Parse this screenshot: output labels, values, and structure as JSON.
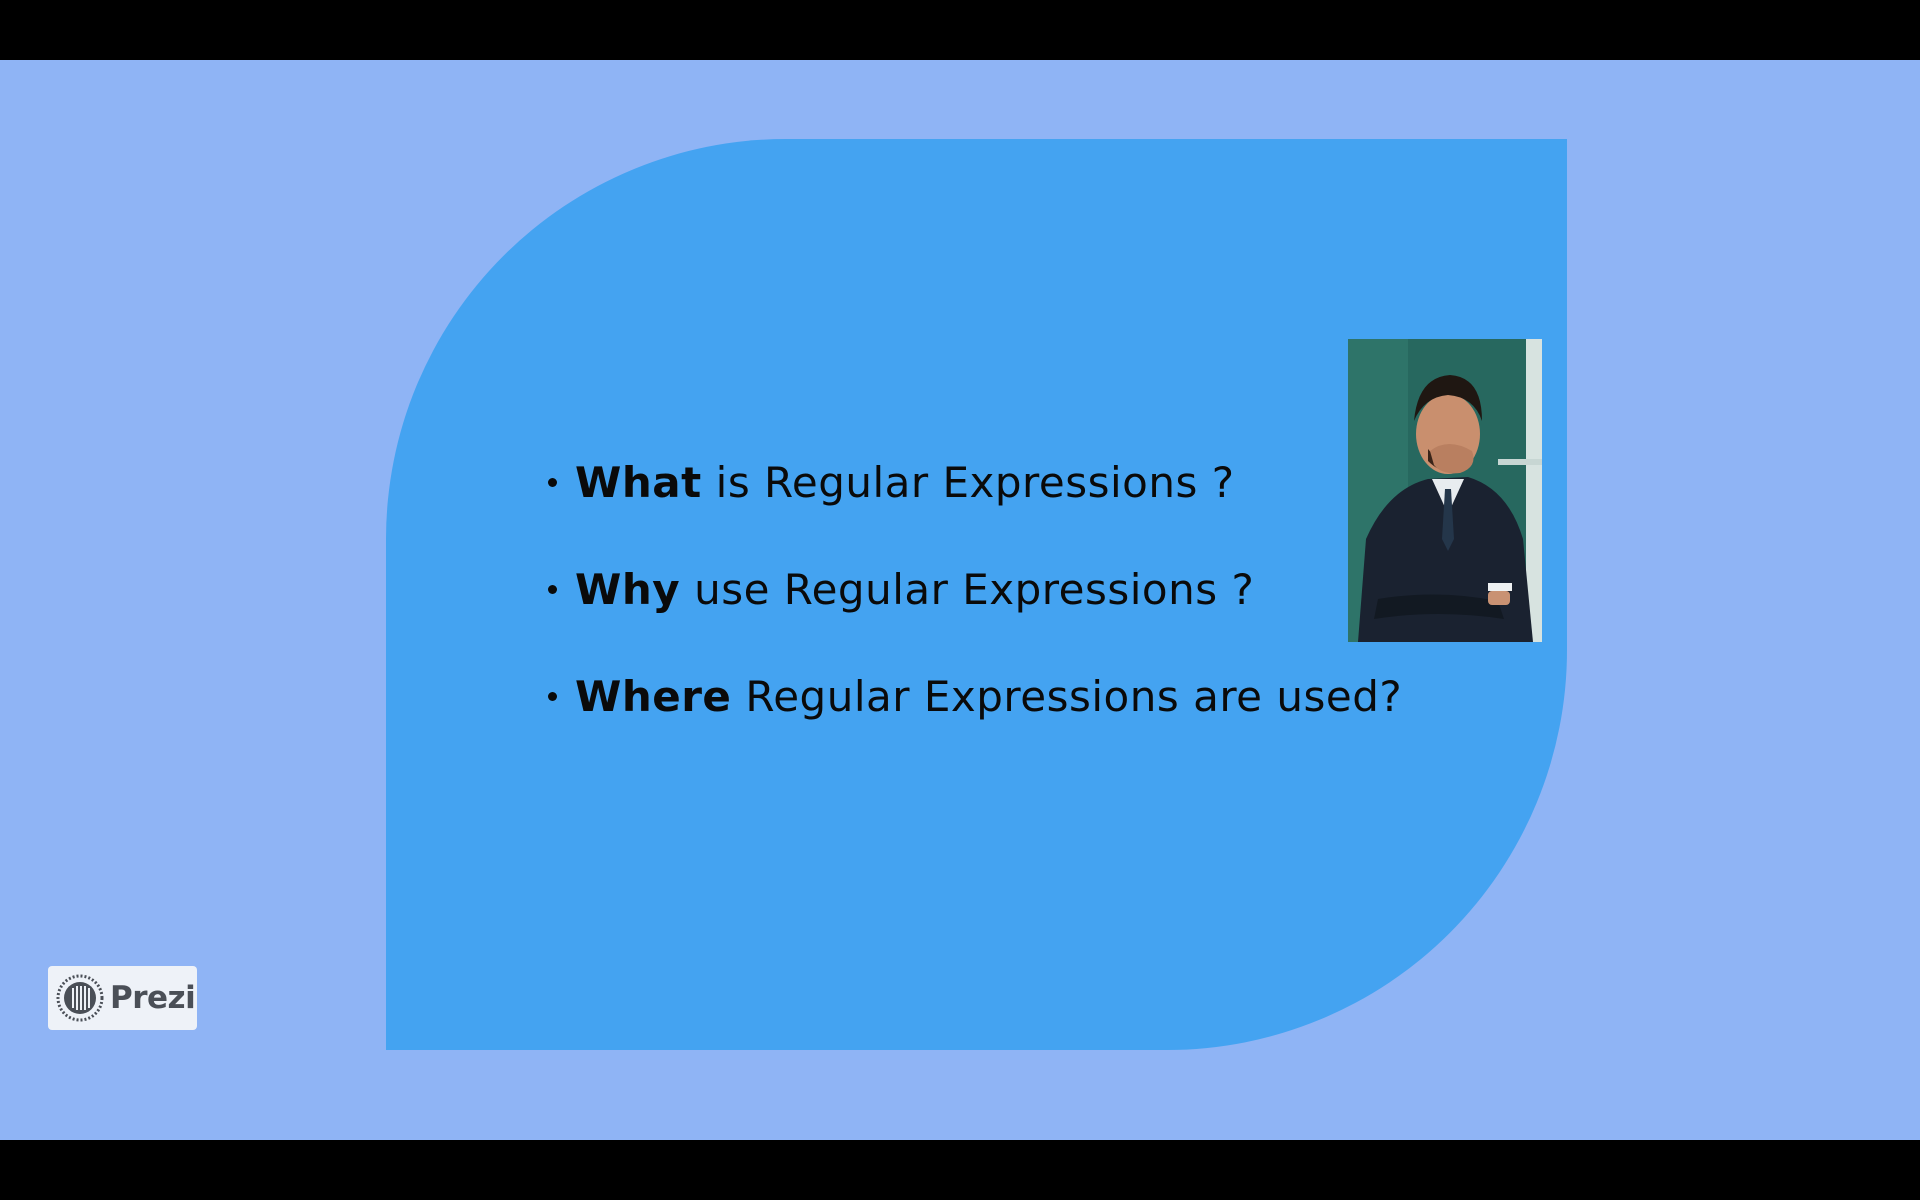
{
  "slide": {
    "bullets": [
      {
        "strong": "What",
        "rest": "is Regular Expressions ?"
      },
      {
        "strong": "Why",
        "rest": "use Regular Expressions ?"
      },
      {
        "strong": "Where",
        "rest": "Regular Expressions are used?"
      }
    ],
    "photo_icon": "portrait-photo"
  },
  "branding": {
    "logo_text": "Prezi",
    "logo_icon": "prezi-logo-icon"
  },
  "colors": {
    "frame": "#000000",
    "background": "#8fb4f5",
    "shape": "#44a3f1",
    "text": "#0a0a0a",
    "badge": "#eef2f8"
  }
}
